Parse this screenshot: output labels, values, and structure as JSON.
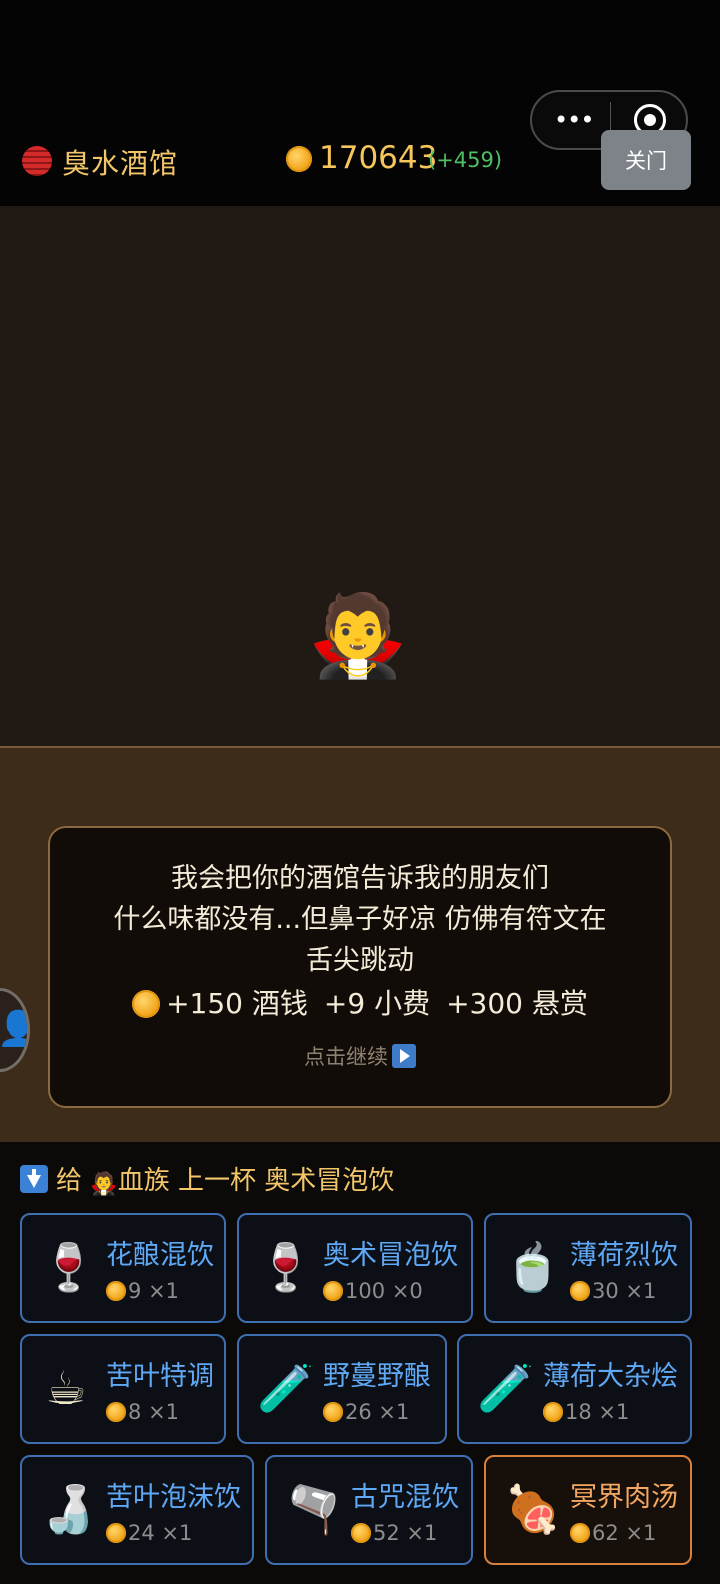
{
  "header": {
    "tavern_name": "臭水酒馆",
    "gold": "170643",
    "gold_delta": "(+459)",
    "close_label": "关门"
  },
  "scene": {
    "npc_emoji": "🧛"
  },
  "dialog": {
    "line1": "我会把你的酒馆告诉我的朋友们",
    "line2": "什么味都没有...但鼻子好凉 仿佛有符文在",
    "line3": "舌尖跳动",
    "reward_drink": "+150 酒钱",
    "reward_tip": "+9 小费",
    "reward_bounty": "+300 悬赏",
    "continue_label": "点击继续"
  },
  "serve": {
    "give": "给",
    "npc_emoji": "🧛",
    "target": "血族",
    "action": "上一杯",
    "drink": "奥术冒泡饮"
  },
  "drinks": [
    {
      "icon": "🍷",
      "name": "花酿混饮",
      "cost": "9",
      "qty": "×1"
    },
    {
      "icon": "🍷",
      "name": "奥术冒泡饮",
      "cost": "100",
      "qty": "×0"
    },
    {
      "icon": "🍵",
      "name": "薄荷烈饮",
      "cost": "30",
      "qty": "×1"
    },
    {
      "icon": "☕",
      "name": "苦叶特调",
      "cost": "8",
      "qty": "×1"
    },
    {
      "icon": "🧪",
      "name": "野蔓野酿",
      "cost": "26",
      "qty": "×1"
    },
    {
      "icon": "🧪",
      "name": "薄荷大杂烩",
      "cost": "18",
      "qty": "×1"
    },
    {
      "icon": "🍶",
      "name": "苦叶泡沫饮",
      "cost": "24",
      "qty": "×1"
    },
    {
      "icon": "🫗",
      "name": "古咒混饮",
      "cost": "52",
      "qty": "×1"
    },
    {
      "icon": "🍖",
      "name": "冥界肉汤",
      "cost": "62",
      "qty": "×1"
    }
  ],
  "colors": {
    "accent_gold": "#f3c66a",
    "drink_name": "#5fa8f5",
    "special_drink": "#f4a762",
    "delta_green": "#4fbf63"
  }
}
